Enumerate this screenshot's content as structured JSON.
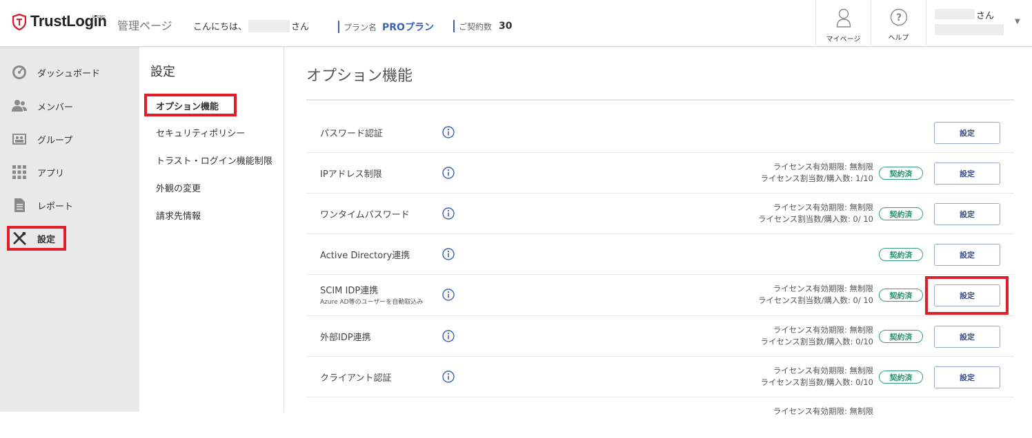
{
  "header": {
    "logo_text": "TrustLogin",
    "logo_sub": "by GMO",
    "admin_title": "管理ページ",
    "greeting_prefix": "こんにちは、",
    "greeting_suffix": "さん",
    "plan_label": "プラン名",
    "plan_value": "PROプラン",
    "contract_label": "ご契約数",
    "contract_value": "30",
    "mypage_label": "マイページ",
    "help_label": "ヘルプ",
    "user_suffix": "さん",
    "user_caret": "▼"
  },
  "leftnav": {
    "items": [
      {
        "label": "ダッシュボード",
        "icon": "dashboard-icon"
      },
      {
        "label": "メンバー",
        "icon": "members-icon"
      },
      {
        "label": "グループ",
        "icon": "group-icon"
      },
      {
        "label": "アプリ",
        "icon": "apps-icon"
      },
      {
        "label": "レポート",
        "icon": "report-icon"
      },
      {
        "label": "設定",
        "icon": "settings-icon",
        "active": true
      }
    ]
  },
  "subnav": {
    "title": "設定",
    "items": [
      {
        "label": "オプション機能",
        "active": true
      },
      {
        "label": "セキュリティポリシー"
      },
      {
        "label": "トラスト・ログイン機能制限"
      },
      {
        "label": "外観の変更"
      },
      {
        "label": "請求先情報"
      }
    ]
  },
  "main": {
    "title": "オプション機能",
    "rows": [
      {
        "name": "パスワード認証",
        "btn": "設定"
      },
      {
        "name": "IPアドレス制限",
        "lic1": "ライセンス有効期限: 無制限",
        "lic2": "ライセンス割当数/購入数: 1/10",
        "badge": "契約済",
        "btn": "設定"
      },
      {
        "name": "ワンタイムパスワード",
        "lic1": "ライセンス有効期限: 無制限",
        "lic2": "ライセンス割当数/購入数: 0/ 10",
        "badge": "契約済",
        "btn": "設定"
      },
      {
        "name": "Active Directory連携",
        "badge": "契約済",
        "btn": "設定"
      },
      {
        "name": "SCIM IDP連携",
        "sub": "Azure AD等のユーザーを自動取込み",
        "lic1": "ライセンス有効期限: 無制限",
        "lic2": "ライセンス割当数/購入数: 0/ 10",
        "badge": "契約済",
        "btn": "設定"
      },
      {
        "name": "外部IDP連携",
        "lic1": "ライセンス有効期限: 無制限",
        "lic2": "ライセンス割当数/購入数: 0/10",
        "badge": "契約済",
        "btn": "設定"
      },
      {
        "name": "クライアント認証",
        "lic1": "ライセンス有効期限: 無制限",
        "lic2": "ライセンス割当数/購入数: 0/10",
        "badge": "契約済",
        "btn": "設定"
      },
      {
        "lic1": "ライセンス有効期限: 無制限"
      }
    ]
  },
  "colors": {
    "accent": "#3a63b8",
    "badge": "#2a9470",
    "highlight": "#e01e2a"
  }
}
